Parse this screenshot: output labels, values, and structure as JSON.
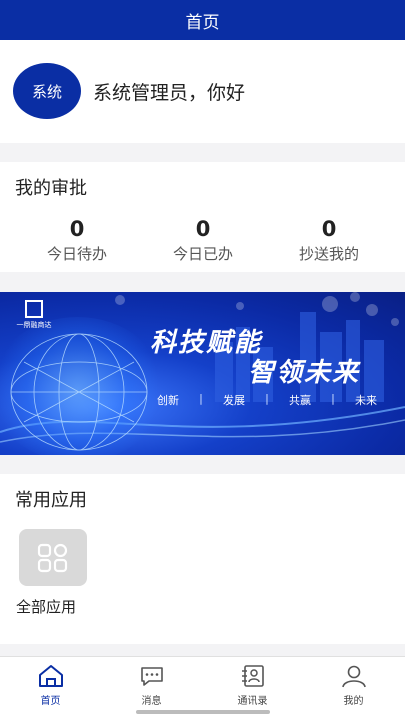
{
  "header": {
    "title": "首页"
  },
  "user": {
    "avatar_text": "系统",
    "greeting": "系统管理员，你好"
  },
  "approval": {
    "title": "我的审批",
    "stats": [
      {
        "value": "0",
        "label": "今日待办"
      },
      {
        "value": "0",
        "label": "今日已办"
      },
      {
        "value": "0",
        "label": "抄送我的"
      }
    ]
  },
  "banner": {
    "logo_text": "一鼎融商达",
    "headline_1": "科技赋能",
    "headline_2": "智领未来",
    "tags": [
      "创新",
      "发展",
      "共赢",
      "未来"
    ],
    "separator": "|"
  },
  "apps": {
    "title": "常用应用",
    "items": [
      {
        "label": "全部应用",
        "icon": "grid-apps-icon"
      }
    ]
  },
  "tabbar": {
    "items": [
      {
        "label": "首页",
        "icon": "home-icon",
        "active": true
      },
      {
        "label": "消息",
        "icon": "chat-icon",
        "active": false
      },
      {
        "label": "通讯录",
        "icon": "contacts-icon",
        "active": false
      },
      {
        "label": "我的",
        "icon": "person-icon",
        "active": false
      }
    ]
  },
  "colors": {
    "primary": "#0a2ea4",
    "tile_bg": "#d9d9d9",
    "background": "#f3f3f5"
  }
}
